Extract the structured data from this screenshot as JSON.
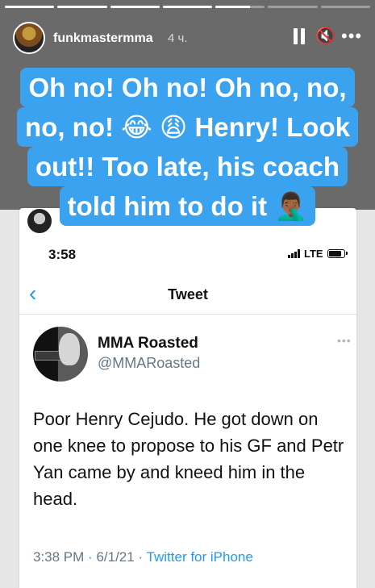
{
  "story": {
    "progress": [
      1,
      1,
      1,
      1,
      0.7,
      0,
      0
    ],
    "username": "funkmastermma",
    "time_ago": "4 ч.",
    "mute_icon": "🔇",
    "more_icon": "•••"
  },
  "caption": {
    "lines": [
      "Oh no! Oh no! Oh no, no,",
      "no, no! 😂 😩 Henry! Look",
      "out!! Too late, his coach",
      "told him to do it 🤦🏾‍♂️"
    ]
  },
  "phone": {
    "time": "3:58",
    "network": "LTE"
  },
  "tweet_screen": {
    "back_icon": "‹",
    "title": "Tweet",
    "author_name": "MMA Roasted",
    "author_handle": "@MMARoasted",
    "more_icon": "•••",
    "text": "Poor Henry Cejudo. He got down on one knee to propose to his GF and Petr Yan came by and kneed him in the head.",
    "time": "3:38 PM",
    "date": "6/1/21",
    "separator": "·",
    "source": "Twitter for iPhone"
  },
  "colors": {
    "caption_bg": "#3aa2ee",
    "link": "#1d9bf0",
    "secondary_text": "#657786"
  }
}
